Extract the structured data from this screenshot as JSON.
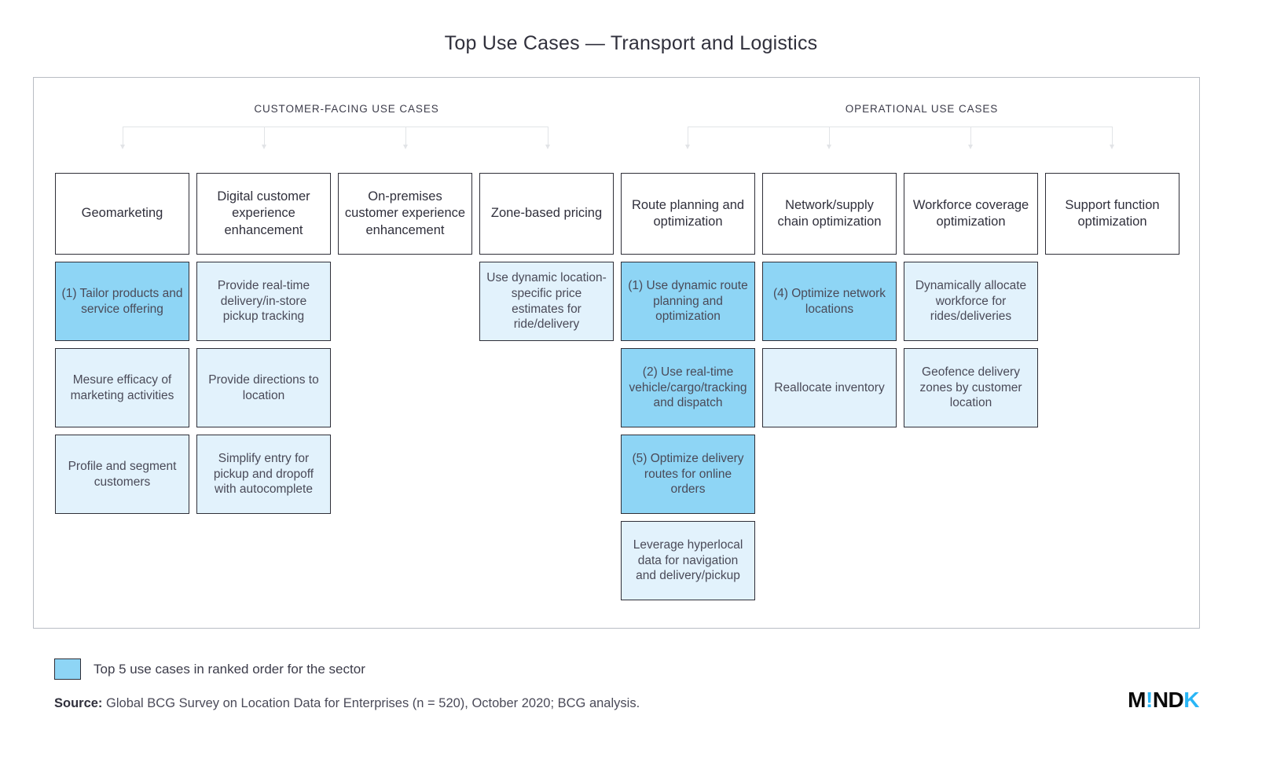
{
  "title": "Top Use Cases — Transport and Logistics",
  "groups": {
    "customer": "CUSTOMER-FACING USE CASES",
    "operational": "OPERATIONAL USE CASES"
  },
  "columns": [
    {
      "header": "Geomarketing",
      "items": [
        {
          "text": "(1) Tailor products and service offering",
          "ranked": true
        },
        {
          "text": "Mesure efficacy of marketing activities",
          "ranked": false
        },
        {
          "text": "Profile and segment customers",
          "ranked": false
        }
      ]
    },
    {
      "header": "Digital customer experience enhancement",
      "items": [
        {
          "text": "Provide real-time delivery/in-store pickup tracking",
          "ranked": false
        },
        {
          "text": "Provide directions to location",
          "ranked": false
        },
        {
          "text": "Simplify entry for pickup and dropoff with autocomplete",
          "ranked": false
        }
      ]
    },
    {
      "header": "On-premises customer experience enhancement",
      "items": []
    },
    {
      "header": "Zone-based pricing",
      "items": [
        {
          "text": "Use dynamic location-specific price estimates for ride/delivery",
          "ranked": false
        }
      ]
    },
    {
      "header": "Route planning and optimization",
      "items": [
        {
          "text": "(1) Use dynamic route planning and optimization",
          "ranked": true
        },
        {
          "text": "(2) Use real-time vehicle/cargo/tracking and dispatch",
          "ranked": true
        },
        {
          "text": "(5) Optimize delivery routes for online orders",
          "ranked": true
        },
        {
          "text": "Leverage hyperlocal data for navigation and delivery/pickup",
          "ranked": false
        }
      ]
    },
    {
      "header": "Network/supply chain optimization",
      "items": [
        {
          "text": "(4) Optimize network locations",
          "ranked": true
        },
        {
          "text": "Reallocate inventory",
          "ranked": false
        }
      ]
    },
    {
      "header": "Workforce coverage optimization",
      "items": [
        {
          "text": "Dynamically allocate workforce for rides/deliveries",
          "ranked": false
        },
        {
          "text": "Geofence delivery zones by customer location",
          "ranked": false
        }
      ]
    },
    {
      "header": "Support function optimization",
      "items": []
    }
  ],
  "legend": {
    "label": "Top 5 use cases in ranked order for the sector",
    "swatch_color": "#8ed5f5"
  },
  "source": {
    "lead": "Source:",
    "text": " Global BCG Survey on Location Data for Enterprises (n = 520), October 2020; BCG analysis."
  },
  "logo": {
    "part1": "M",
    "accent1": "!",
    "part2": "ND",
    "accent2": "K",
    "accent_color": "#29b6f6"
  },
  "colors": {
    "ranked_fill": "#8ed5f5",
    "item_fill": "#e2f2fc",
    "border": "#2f2f38",
    "connector": "#e2e4e7"
  }
}
